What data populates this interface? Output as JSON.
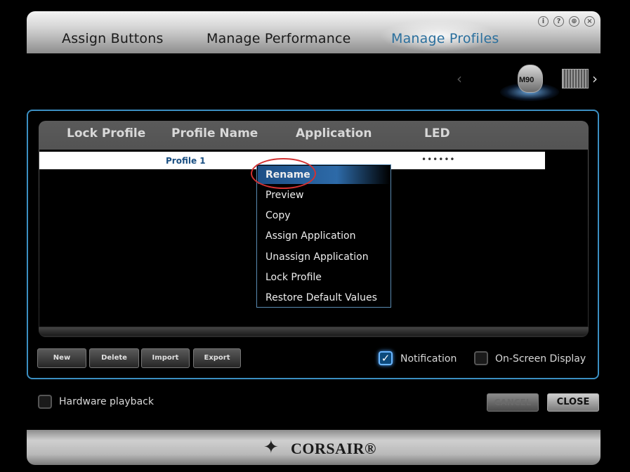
{
  "header": {
    "tabs": [
      {
        "label": "Assign Buttons"
      },
      {
        "label": "Manage Performance"
      },
      {
        "label": "Manage Profiles",
        "active": true
      }
    ],
    "icons": [
      "info-icon",
      "help-icon",
      "globe-icon",
      "close-icon"
    ],
    "icon_glyphs": [
      "i",
      "?",
      "⊕",
      "×"
    ]
  },
  "devices": {
    "prev_glyph": "‹",
    "next_glyph": "›",
    "selected_label": "M90"
  },
  "profiles_table": {
    "columns": [
      "Lock Profile",
      "Profile Name",
      "Application",
      "LED"
    ],
    "rows": [
      {
        "lock": "",
        "name": "Profile 1",
        "application": "",
        "led": "••••••"
      }
    ]
  },
  "context_menu": {
    "items": [
      "Rename",
      "Preview",
      "Copy",
      "Assign Application",
      "Unassign Application",
      "Lock Profile",
      "Restore Default Values"
    ],
    "highlighted_index": 0
  },
  "toolbar": {
    "new_label": "New",
    "delete_label": "Delete",
    "import_label": "Import",
    "export_label": "Export"
  },
  "options": {
    "notification_label": "Notification",
    "notification_checked": true,
    "notification_check_glyph": "✓",
    "osd_label": "On-Screen Display",
    "osd_checked": false,
    "hardware_playback_label": "Hardware playback",
    "hardware_playback_checked": false
  },
  "actions": {
    "cancel_label": "CANCEL",
    "close_label": "CLOSE"
  },
  "brand": {
    "name": "CORSAIR®",
    "mark_glyph": "✦"
  },
  "colors": {
    "accent": "#3b8fc2",
    "active_tab": "#2a6f9d",
    "annotation_circle": "#d23232"
  }
}
